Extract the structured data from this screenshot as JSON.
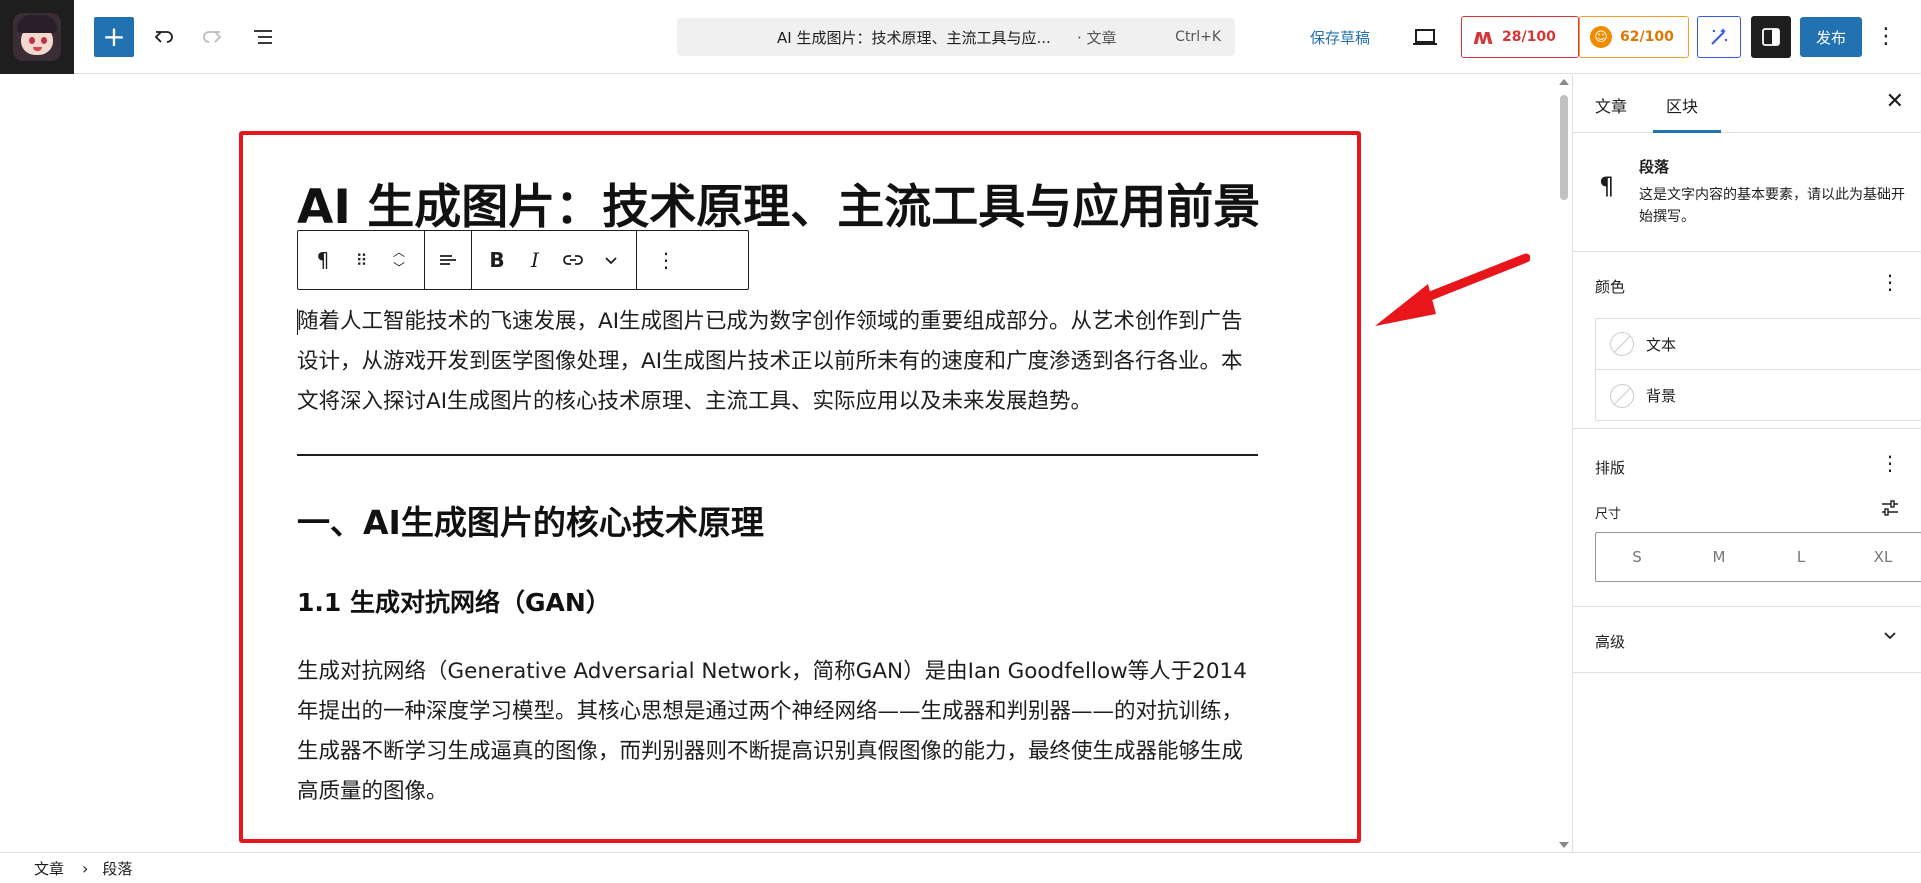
{
  "header": {
    "document_title": "AI 生成图片：技术原理、主流工具与应...",
    "document_kind": "· 文章",
    "shortcut": "Ctrl+K",
    "save_draft_label": "保存草稿",
    "seo_score": "28/100",
    "readability_score": "62/100",
    "publish_label": "发布"
  },
  "post": {
    "title": "AI 生成图片：技术原理、主流工具与应用前景",
    "intro": "随着人工智能技术的飞速发展，AI生成图片已成为数字创作领域的重要组成部分。从艺术创作到广告设计，从游戏开发到医学图像处理，AI生成图片技术正以前所未有的速度和广度渗透到各行各业。本文将深入探讨AI生成图片的核心技术原理、主流工具、实际应用以及未来发展趋势。",
    "heading_1": "一、AI生成图片的核心技术原理",
    "heading_1_1": "1.1 生成对抗网络（GAN）",
    "gan_paragraph": "生成对抗网络（Generative Adversarial Network，简称GAN）是由Ian Goodfellow等人于2014年提出的一种深度学习模型。其核心思想是通过两个神经网络——生成器和判别器——的对抗训练，生成器不断学习生成逼真的图像，而判别器则不断提高识别真假图像的能力，最终使生成器能够生成高质量的图像。"
  },
  "sidebar": {
    "tabs": [
      "文章",
      "区块"
    ],
    "active_tab": "区块",
    "block_name": "段落",
    "block_description": "这是文字内容的基本要素，请以此为基础开始撰写。",
    "color_title": "颜色",
    "color_items": [
      "文本",
      "背景"
    ],
    "typography_title": "排版",
    "size_label": "尺寸",
    "size_options": [
      "S",
      "M",
      "L",
      "XL"
    ],
    "advanced_title": "高级"
  },
  "breadcrumb": [
    "文章",
    "段落"
  ],
  "colors": {
    "accent": "#2271b1",
    "highlight": "#e8151b",
    "seo_red": "#d63638",
    "readability_orange": "#f08c00"
  },
  "icons": {
    "add": "plus-icon",
    "undo": "undo-icon",
    "redo": "redo-icon",
    "list_view": "list-view-icon",
    "paragraph": "pilcrow-icon",
    "annotation": "red-arrow"
  }
}
